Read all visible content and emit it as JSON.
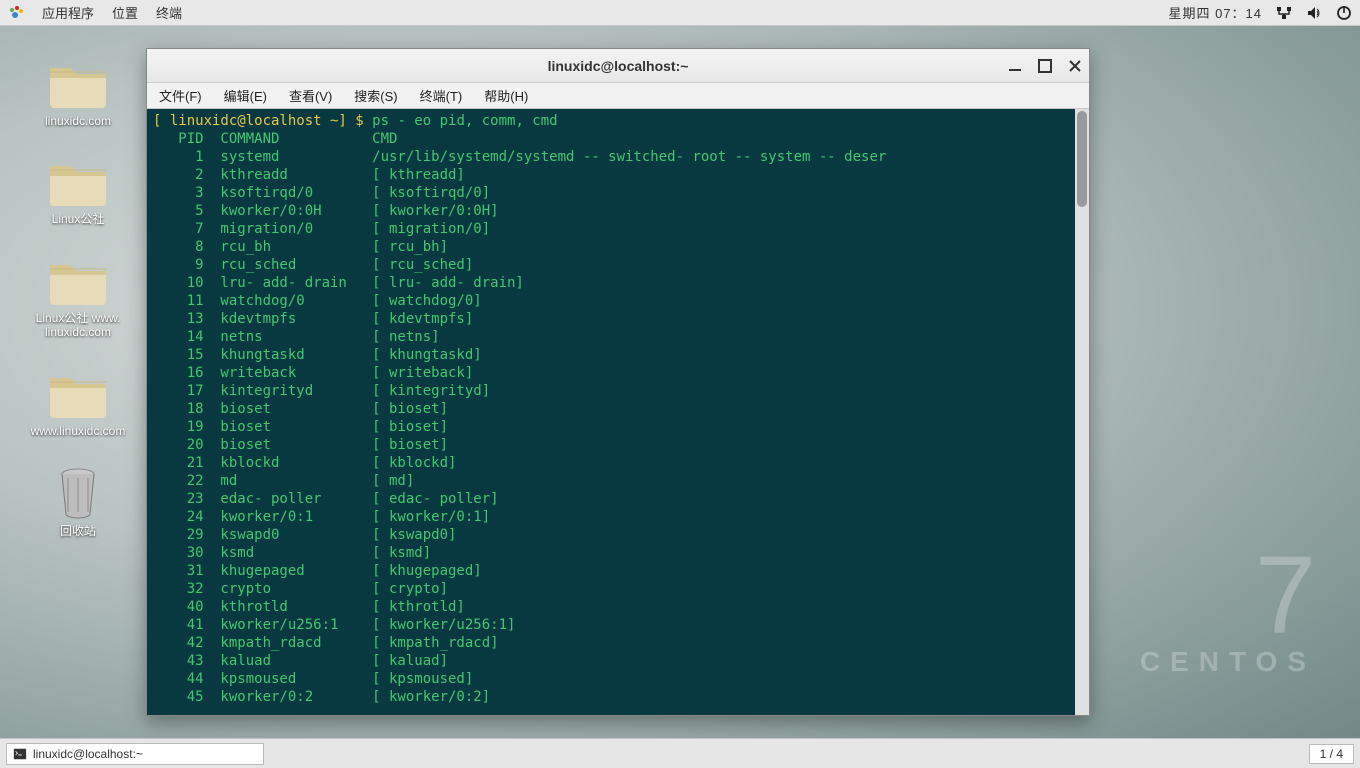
{
  "top_panel": {
    "apps": "应用程序",
    "places": "位置",
    "terminal": "终端",
    "clock": "星期四 07：14"
  },
  "desktop": {
    "icons": [
      {
        "label": "linuxidc.com"
      },
      {
        "label": "Linux公社"
      },
      {
        "label": "Linux公社 www.\nlinuxidc.com"
      },
      {
        "label": "www.linuxidc.com"
      }
    ],
    "trash": "回收站"
  },
  "centos": {
    "num": "7",
    "name": "CENTOS"
  },
  "window": {
    "title": "linuxidc@localhost:~",
    "menu": [
      "文件(F)",
      "编辑(E)",
      "查看(V)",
      "搜索(S)",
      "终端(T)",
      "帮助(H)"
    ]
  },
  "terminal": {
    "prompt_user": "[ linuxidc@localhost ~] $ ",
    "command": "ps - eo pid, comm, cmd",
    "header": {
      "pid": "PID",
      "command": "COMMAND",
      "cmd": "CMD"
    },
    "rows": [
      {
        "pid": "1",
        "comm": "systemd",
        "cmd": "/usr/lib/systemd/systemd -- switched- root -- system -- deser"
      },
      {
        "pid": "2",
        "comm": "kthreadd",
        "cmd": "[ kthreadd]"
      },
      {
        "pid": "3",
        "comm": "ksoftirqd/0",
        "cmd": "[ ksoftirqd/0]"
      },
      {
        "pid": "5",
        "comm": "kworker/0:0H",
        "cmd": "[ kworker/0:0H]"
      },
      {
        "pid": "7",
        "comm": "migration/0",
        "cmd": "[ migration/0]"
      },
      {
        "pid": "8",
        "comm": "rcu_bh",
        "cmd": "[ rcu_bh]"
      },
      {
        "pid": "9",
        "comm": "rcu_sched",
        "cmd": "[ rcu_sched]"
      },
      {
        "pid": "10",
        "comm": "lru- add- drain",
        "cmd": "[ lru- add- drain]"
      },
      {
        "pid": "11",
        "comm": "watchdog/0",
        "cmd": "[ watchdog/0]"
      },
      {
        "pid": "13",
        "comm": "kdevtmpfs",
        "cmd": "[ kdevtmpfs]"
      },
      {
        "pid": "14",
        "comm": "netns",
        "cmd": "[ netns]"
      },
      {
        "pid": "15",
        "comm": "khungtaskd",
        "cmd": "[ khungtaskd]"
      },
      {
        "pid": "16",
        "comm": "writeback",
        "cmd": "[ writeback]"
      },
      {
        "pid": "17",
        "comm": "kintegrityd",
        "cmd": "[ kintegrityd]"
      },
      {
        "pid": "18",
        "comm": "bioset",
        "cmd": "[ bioset]"
      },
      {
        "pid": "19",
        "comm": "bioset",
        "cmd": "[ bioset]"
      },
      {
        "pid": "20",
        "comm": "bioset",
        "cmd": "[ bioset]"
      },
      {
        "pid": "21",
        "comm": "kblockd",
        "cmd": "[ kblockd]"
      },
      {
        "pid": "22",
        "comm": "md",
        "cmd": "[ md]"
      },
      {
        "pid": "23",
        "comm": "edac- poller",
        "cmd": "[ edac- poller]"
      },
      {
        "pid": "24",
        "comm": "kworker/0:1",
        "cmd": "[ kworker/0:1]"
      },
      {
        "pid": "29",
        "comm": "kswapd0",
        "cmd": "[ kswapd0]"
      },
      {
        "pid": "30",
        "comm": "ksmd",
        "cmd": "[ ksmd]"
      },
      {
        "pid": "31",
        "comm": "khugepaged",
        "cmd": "[ khugepaged]"
      },
      {
        "pid": "32",
        "comm": "crypto",
        "cmd": "[ crypto]"
      },
      {
        "pid": "40",
        "comm": "kthrotld",
        "cmd": "[ kthrotld]"
      },
      {
        "pid": "41",
        "comm": "kworker/u256:1",
        "cmd": "[ kworker/u256:1]"
      },
      {
        "pid": "42",
        "comm": "kmpath_rdacd",
        "cmd": "[ kmpath_rdacd]"
      },
      {
        "pid": "43",
        "comm": "kaluad",
        "cmd": "[ kaluad]"
      },
      {
        "pid": "44",
        "comm": "kpsmoused",
        "cmd": "[ kpsmoused]"
      },
      {
        "pid": "45",
        "comm": "kworker/0:2",
        "cmd": "[ kworker/0:2]"
      }
    ]
  },
  "taskbar": {
    "task_label": "linuxidc@localhost:~",
    "workspace": "1 / 4"
  }
}
